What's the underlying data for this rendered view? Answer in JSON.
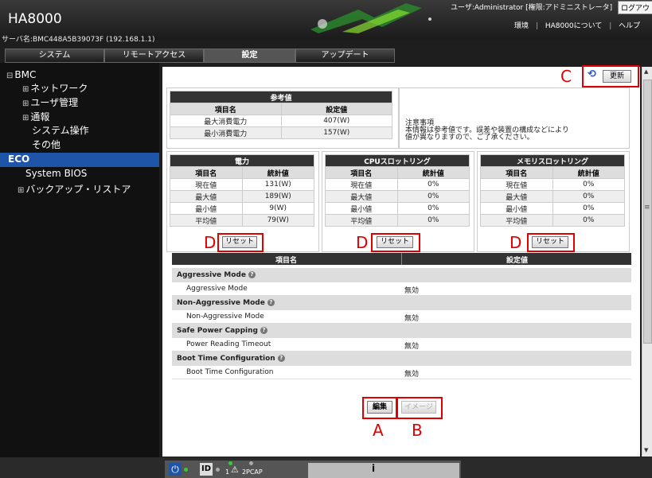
{
  "header": {
    "app_title": "HA8000",
    "server_name": "サーバ名:BMC448A5B39073F (192.168.1.1)",
    "user_info": "ユーザ:Administrator [権限:アドミニストレータ]",
    "logout": "ログアウト",
    "links": [
      "環境",
      "HA8000について",
      "ヘルプ"
    ]
  },
  "tabs": [
    {
      "label": "システム"
    },
    {
      "label": "リモートアクセス"
    },
    {
      "label": "設定"
    },
    {
      "label": "アップデート"
    }
  ],
  "sidebar": {
    "items": [
      {
        "label": "BMC"
      },
      {
        "label": "ネットワーク"
      },
      {
        "label": "ユーザ管理"
      },
      {
        "label": "通報"
      },
      {
        "label": "システム操作"
      },
      {
        "label": "その他"
      },
      {
        "label": "ECO"
      },
      {
        "label": "System BIOS"
      },
      {
        "label": "バックアップ・リストア"
      }
    ]
  },
  "refresh": {
    "label": "更新"
  },
  "reference": {
    "title": "参考値",
    "headers": [
      "項目名",
      "設定値"
    ],
    "rows": [
      {
        "name": "最大消費電力",
        "value": "407(W)"
      },
      {
        "name": "最小消費電力",
        "value": "157(W)"
      }
    ]
  },
  "notice": {
    "title": "注意事項",
    "line1": "本情報は参考値です。誤差や装置の構成などにより",
    "line2": "値が異なりますので、ご了承ください。"
  },
  "stats_headers": [
    "項目名",
    "統計値"
  ],
  "stats_row_names": [
    "現在値",
    "最大値",
    "最小値",
    "平均値"
  ],
  "stats": [
    {
      "title": "電力",
      "values": [
        "131(W)",
        "189(W)",
        "9(W)",
        "79(W)"
      ]
    },
    {
      "title": "CPUスロットリング",
      "values": [
        "0%",
        "0%",
        "0%",
        "0%"
      ]
    },
    {
      "title": "メモリスロットリング",
      "values": [
        "0%",
        "0%",
        "0%",
        "0%"
      ]
    }
  ],
  "reset_label": "リセット",
  "settings": {
    "headers": [
      "項目名",
      "設定値"
    ],
    "sections": [
      {
        "title": "Aggressive Mode",
        "item": "Aggressive Mode",
        "value": "無効"
      },
      {
        "title": "Non-Aggressive Mode",
        "item": "Non-Aggressive Mode",
        "value": "無効"
      },
      {
        "title": "Safe Power Capping",
        "item": "Power Reading Timeout",
        "value": "無効"
      },
      {
        "title": "Boot Time Configuration",
        "item": "Boot Time Configuration",
        "value": "無効"
      }
    ]
  },
  "actions": {
    "edit": "編集",
    "image": "イメージ"
  },
  "annotations": {
    "a": "A",
    "b": "B",
    "c": "C",
    "d": "D"
  },
  "status_bar": {
    "labels": [
      "ID",
      "1",
      "2",
      "PCAP",
      "i"
    ]
  },
  "icons": [
    "help-icon",
    "refresh-icon",
    "power-icon",
    "warning-icon"
  ],
  "colors": {
    "accent": "#1f55a8",
    "annotation": "#e00000",
    "header_dark": "#333333"
  }
}
